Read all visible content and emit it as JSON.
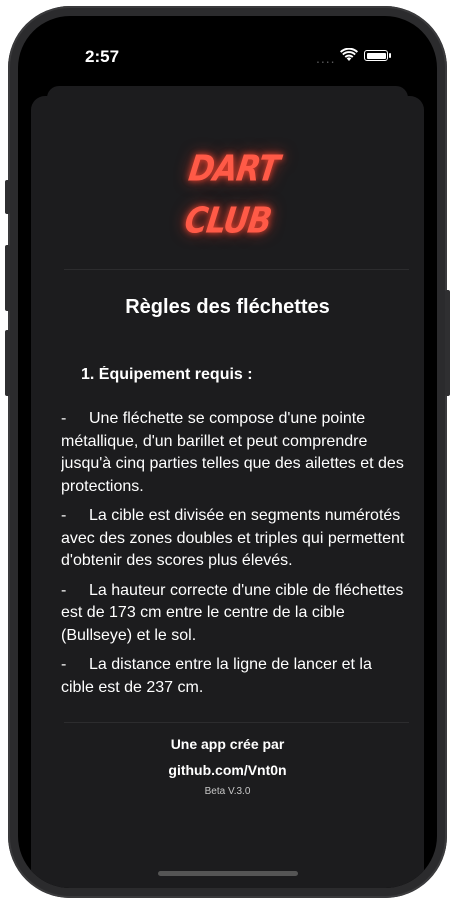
{
  "status_bar": {
    "time": "2:57",
    "signal": "....",
    "wifi_icon": "wifi-icon",
    "battery_icon": "battery-icon"
  },
  "logo": {
    "line1": "DART",
    "line2": "CLUB",
    "color": "#ff5a47"
  },
  "page": {
    "title": "Règles des fléchettes",
    "section_title": "1. Équipement requis :",
    "paragraphs": [
      {
        "dash": "-",
        "text": "Une fléchette se compose d'une pointe métallique, d'un barillet et peut comprendre jusqu'à cinq parties telles que des ailettes et des protections."
      },
      {
        "dash": "-",
        "text": "La cible est divisée en segments numérotés avec des zones doubles et triples qui permettent d'obtenir des scores plus élevés."
      },
      {
        "dash": "-",
        "text": "La hauteur correcte d'une cible de fléchettes est de 173 cm entre le centre de la cible (Bullseye) et le sol."
      },
      {
        "dash": "-",
        "text": "La distance entre la ligne de lancer et la cible est de 237 cm."
      }
    ]
  },
  "footer": {
    "credit": "Une app crée par",
    "author": "github.com/Vnt0n",
    "version": "Beta V.3.0"
  }
}
